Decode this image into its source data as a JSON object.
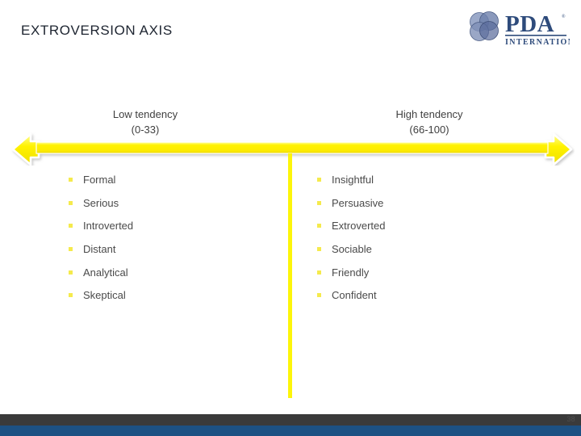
{
  "slide": {
    "title": "EXTROVERSION  AXIS",
    "page_number": "38"
  },
  "logo": {
    "name": "pda-international-logo",
    "primary_text": "PDA",
    "secondary_text": "INTERNATIONAL",
    "trademark": "®",
    "mark_color": "#6d7fa8",
    "text_color": "#2e4b7b"
  },
  "axis": {
    "low": {
      "heading": "Low tendency",
      "range": "(0-33)"
    },
    "high": {
      "heading": "High tendency",
      "range": "(66-100)"
    },
    "arrow_color": "#fff200",
    "arrow_highlight": "#ffff7a",
    "divider_color": "#fdf50a"
  },
  "columns": {
    "low_traits": [
      "Formal",
      "Serious",
      "Introverted",
      "Distant",
      "Analytical",
      "Skeptical"
    ],
    "high_traits": [
      "Insightful",
      "Persuasive",
      "Extroverted",
      "Sociable",
      "Friendly",
      "Confident"
    ],
    "bullet_color": "#f5ea4d",
    "text_color": "#4a4a4a"
  },
  "footer": {
    "dark_bar_color": "#3a3a3a",
    "blue_bar_color": "#1d5183"
  }
}
